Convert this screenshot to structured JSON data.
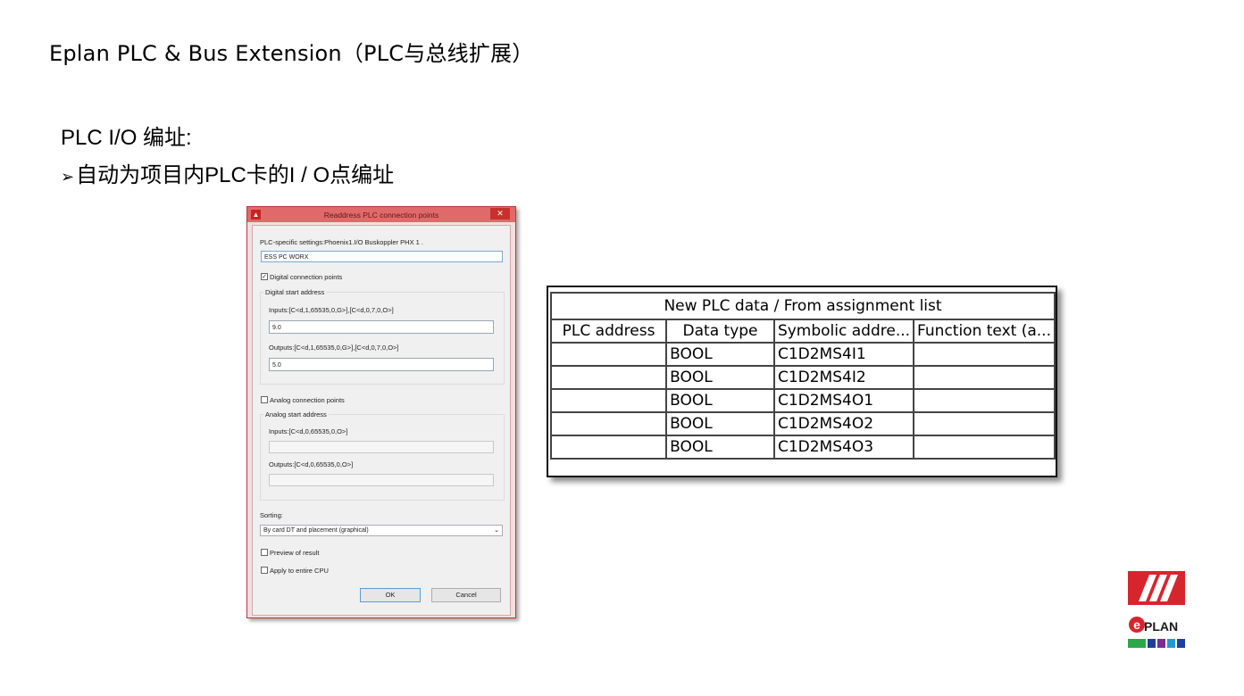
{
  "slide": {
    "title": "Eplan PLC & Bus Extension（PLC与总线扩展）",
    "heading": "PLC I/O 编址:",
    "bullet_arrow": "➢",
    "bullet": "自动为项目内PLC卡的I / O点编址"
  },
  "dialog": {
    "title": "Readdress PLC connection points",
    "close": "✕",
    "plc_settings_label": "PLC-specific settings:Phoenix1.I/O Buskoppler PHX 1 .",
    "plc_settings_value": "ESS PC WORX",
    "digital_check": "✓",
    "digital_label": "Digital connection points",
    "digital_group": "Digital start address",
    "digital_inputs_label": "Inputs:[C<d,1,65535,0,G>],[C<d,0,7,0,O>]",
    "digital_inputs_value": "9.0",
    "digital_outputs_label": "Outputs:[C<d,1,65535,0,G>],[C<d,0,7,0,O>]",
    "digital_outputs_value": "5.0",
    "analog_label": "Analog connection points",
    "analog_group": "Analog start address",
    "analog_inputs_label": "Inputs:[C<d,0,65535,0,O>]",
    "analog_outputs_label": "Outputs:[C<d,0,65535,0,O>]",
    "sorting_label": "Sorting:",
    "sorting_value": "By card DT and placement (graphical)",
    "preview_label": "Preview of result",
    "apply_label": "Apply to entire CPU",
    "ok": "OK",
    "cancel": "Cancel"
  },
  "table": {
    "caption": "New PLC data / From assignment list",
    "headers": [
      "PLC address",
      "Data type",
      "Symbolic addre...",
      "Function text (a..."
    ],
    "rows": [
      [
        "",
        "BOOL",
        "C1D2MS4I1",
        ""
      ],
      [
        "",
        "BOOL",
        "C1D2MS4I2",
        ""
      ],
      [
        "",
        "BOOL",
        "C1D2MS4O1",
        ""
      ],
      [
        "",
        "BOOL",
        "C1D2MS4O2",
        ""
      ],
      [
        "",
        "BOOL",
        "C1D2MS4O3",
        ""
      ]
    ]
  },
  "logo": {
    "text": "PLAN",
    "e_letter": "e",
    "colors": {
      "red": "#d7252e",
      "green": "#2aa84a",
      "blue": "#1f3f9c",
      "purple": "#7b2d8e",
      "cyan": "#1f9ad6"
    }
  }
}
